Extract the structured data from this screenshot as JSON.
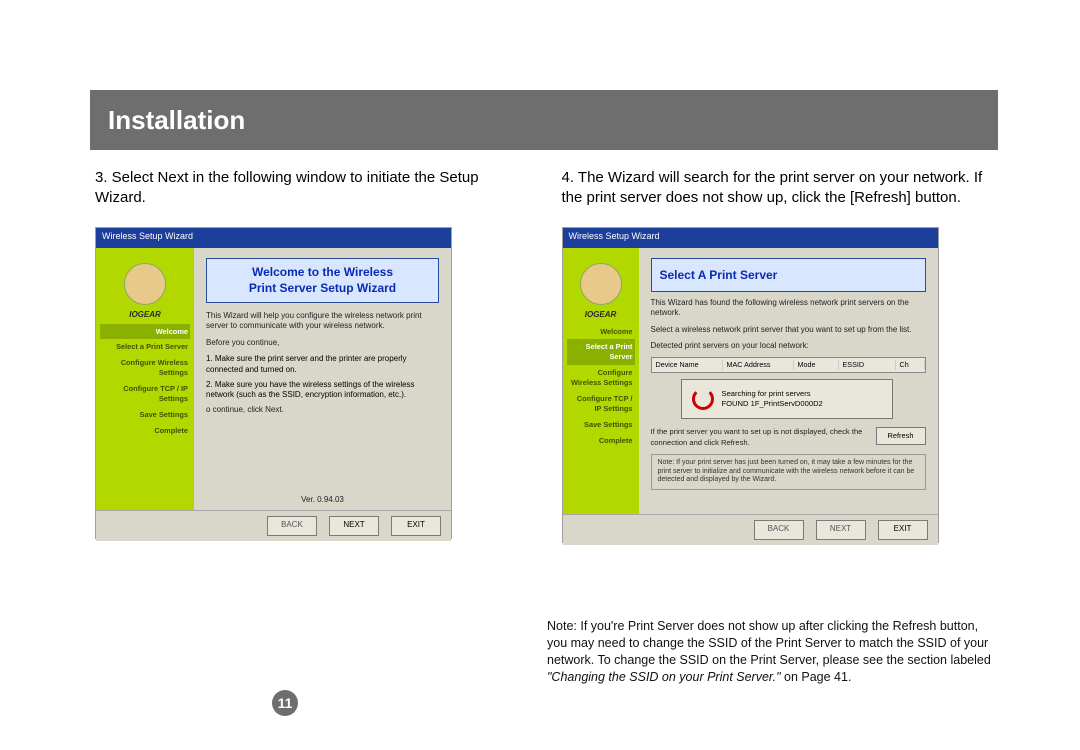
{
  "header": {
    "title": "Installation"
  },
  "left": {
    "step": "3. Select Next in the following window to initiate the Setup Wizard.",
    "wizard": {
      "titlebar": "Wireless Setup Wizard",
      "brand": "IOGEAR",
      "steps": {
        "welcome": "Welcome",
        "select": "Select a Print Server",
        "config": "Configure Wireless\nSettings",
        "tcp": "Configure TCP / IP\nSettings",
        "save": "Save Settings",
        "done": "Complete"
      },
      "banner": {
        "l1": "Welcome to the Wireless",
        "l2": "Print Server Setup Wizard"
      },
      "p1": "This Wizard will help you configure the wireless network print server to communicate with your wireless network.",
      "p2": "Before you continue,",
      "li1": "1. Make sure the print server and the printer are properly connected and turned on.",
      "li2": "2. Make sure you have the wireless settings of the wireless network (such as the SSID, encryption information, etc.).",
      "p3": "o continue, click Next.",
      "ver": "Ver. 0.94.03",
      "btn": {
        "back": "BACK",
        "next": "NEXT",
        "exit": "EXIT"
      }
    }
  },
  "right": {
    "step": "4. The Wizard will search for the print server on your network.  If the print server does not show up, click the [Refresh] button.",
    "wizard": {
      "titlebar": "Wireless Setup Wizard",
      "banner": "Select A Print Server",
      "p1": "This Wizard has found the following wireless network print servers on the network.",
      "p2": "Select a wireless network print server that you want to set up from the list.",
      "p3": "Detected print servers on your local network:",
      "cols": {
        "c1": "Device Name",
        "c2": "MAC Address",
        "c3": "Mode",
        "c4": "ESSID",
        "c5": "Ch"
      },
      "popup": {
        "l1": "Searching for print servers",
        "l2": "FOUND   1F_PrintServD000D2"
      },
      "hint": "If the print server you want to set up is not displayed, check the connection and click Refresh.",
      "refresh": "Refresh",
      "note": "Note: If your print server has just been turned on, it may take a few minutes for the print server to initialize and communicate with the wireless network before it can be detected and displayed by the Wizard.",
      "btn": {
        "back": "BACK",
        "next": "NEXT",
        "exit": "EXIT"
      }
    }
  },
  "footnote": {
    "text": "Note: If you're Print Server does not show up after clicking the Refresh button, you may need to change the SSID of the Print Server to match the SSID of your network. To change the SSID on the Print Server, please see the section labeled ",
    "ital": "\"Changing the SSID on your Print Server.\"",
    "tail": " on Page 41."
  },
  "pagenum": "11"
}
